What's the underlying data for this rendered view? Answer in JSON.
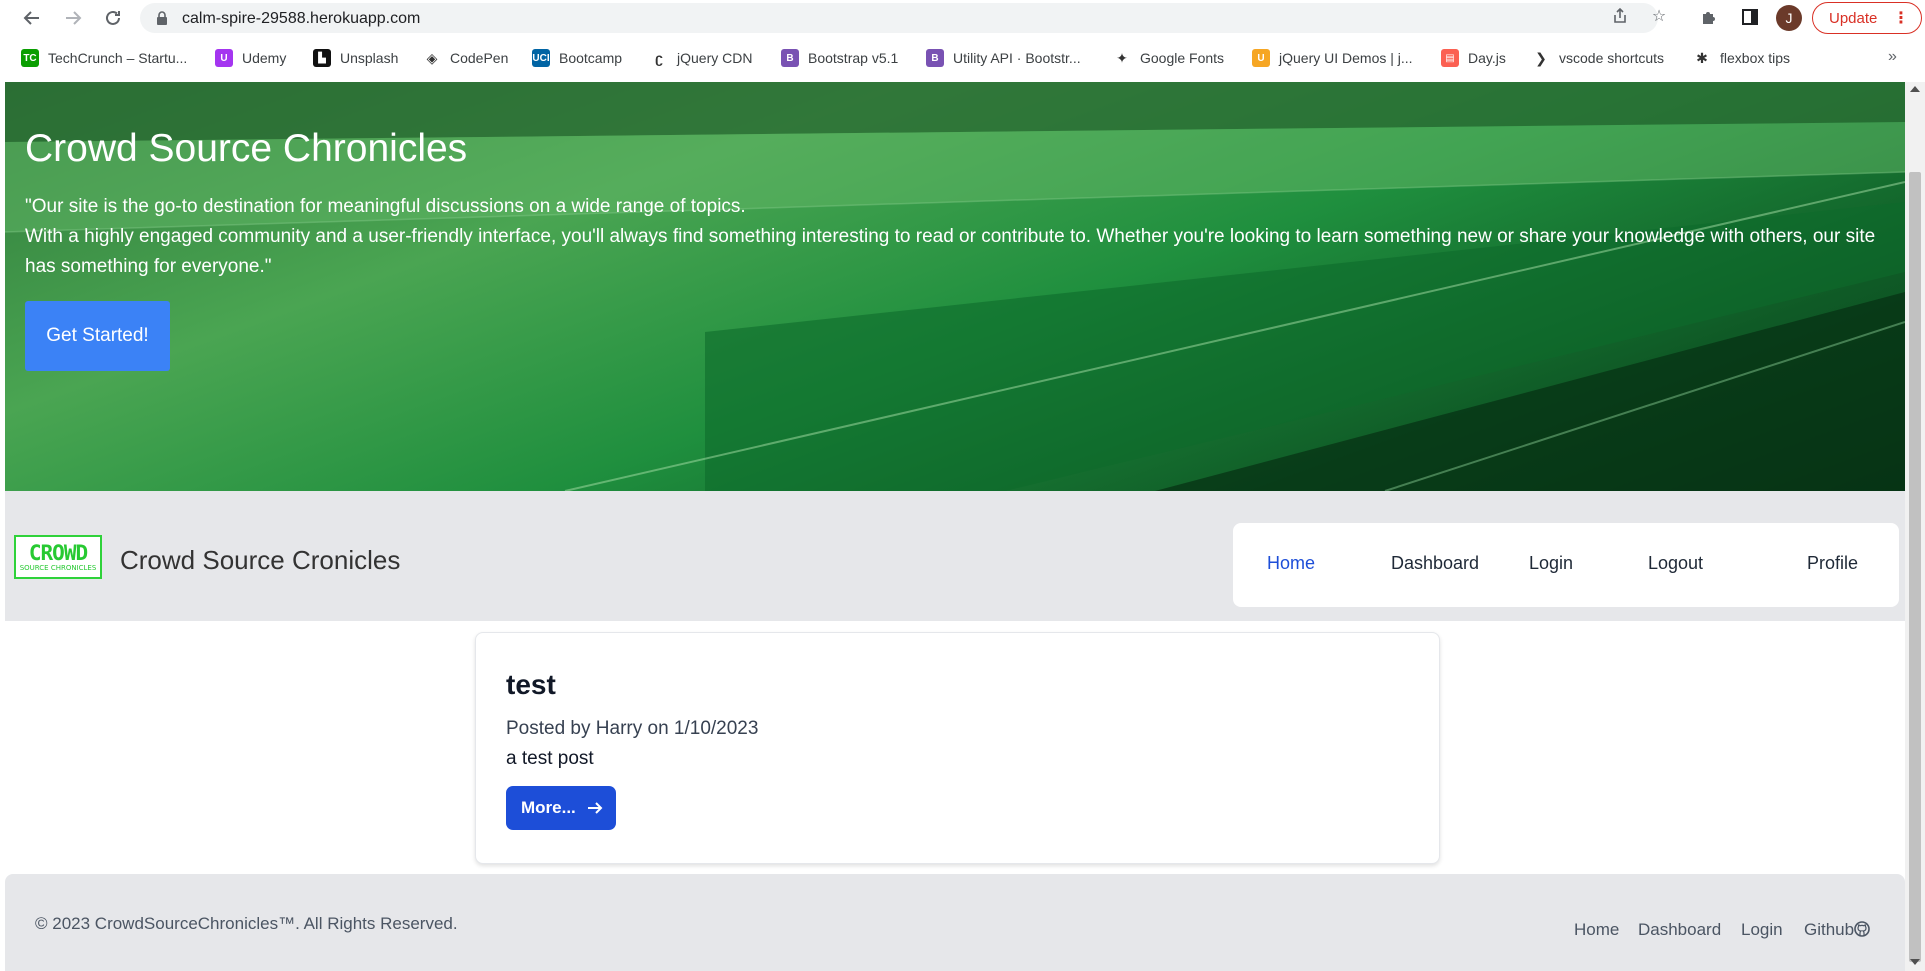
{
  "browser": {
    "url": "calm-spire-29588.herokuapp.com",
    "avatar_initial": "J",
    "update_label": "Update",
    "bookmarks": [
      {
        "label": "TechCrunch – Startu...",
        "icon": "techcrunch-icon",
        "color": "#0a9e01",
        "glyph": "TC"
      },
      {
        "label": "Udemy",
        "icon": "udemy-icon",
        "color": "#a435f0",
        "glyph": "U"
      },
      {
        "label": "Unsplash",
        "icon": "unsplash-icon",
        "color": "#111111",
        "glyph": "▙"
      },
      {
        "label": "CodePen",
        "icon": "codepen-icon",
        "color": "#ffffff",
        "glyph": "◈"
      },
      {
        "label": "Bootcamp",
        "icon": "uci-icon",
        "color": "#0064a4",
        "glyph": "UCI"
      },
      {
        "label": "jQuery CDN",
        "icon": "jquery-icon",
        "color": "#ffffff",
        "glyph": "ʗ"
      },
      {
        "label": "Bootstrap v5.1",
        "icon": "bootstrap-icon",
        "color": "#7952b3",
        "glyph": "B"
      },
      {
        "label": "Utility API · Bootstr...",
        "icon": "bootstrap-icon",
        "color": "#7952b3",
        "glyph": "B"
      },
      {
        "label": "Google Fonts",
        "icon": "google-fonts-icon",
        "color": "#ffffff",
        "glyph": "✦"
      },
      {
        "label": "jQuery UI Demos | j...",
        "icon": "jquery-ui-icon",
        "color": "#f6a623",
        "glyph": "U"
      },
      {
        "label": "Day.js",
        "icon": "dayjs-icon",
        "color": "#fb6052",
        "glyph": "▤"
      },
      {
        "label": "vscode shortcuts",
        "icon": "vscode-icon",
        "color": "#ffffff",
        "glyph": "❯"
      },
      {
        "label": "flexbox tips",
        "icon": "flexbox-icon",
        "color": "#ffffff",
        "glyph": "✱"
      }
    ]
  },
  "hero": {
    "title": "Crowd Source Chronicles",
    "line1": "\"Our site is the go-to destination for meaningful discussions on a wide range of topics.",
    "line2": "With a highly engaged community and a user-friendly interface, you'll always find something interesting to read or contribute to. Whether you're looking to learn something new or share your knowledge with others, our site has something for everyone.\"",
    "cta": "Get Started!"
  },
  "navbar": {
    "logo_line1": "CROWD",
    "logo_line2": "SOURCE CHRONICLES",
    "brand": "Crowd Source Cronicles",
    "links": [
      "Home",
      "Dashboard",
      "Login",
      "Logout",
      "Profile"
    ]
  },
  "post": {
    "title": "test",
    "meta": "Posted by Harry on 1/10/2023",
    "body": "a test post",
    "more_label": "More..."
  },
  "footer": {
    "copyright": "© 2023 CrowdSourceChronicles™. All Rights Reserved.",
    "links": [
      "Home",
      "Dashboard",
      "Login",
      "Github"
    ]
  },
  "colors": {
    "accent": "#3b82f6",
    "link_active": "#1d4ed8",
    "more_button": "#1d4ed8",
    "logo_green": "#27c932",
    "update_red": "#d93025"
  }
}
